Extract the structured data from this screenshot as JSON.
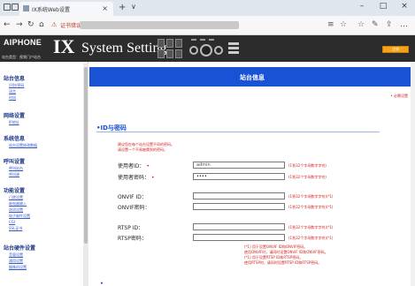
{
  "browser": {
    "tab_title": "IX系统Web设置",
    "tab_close": "×",
    "new_tab": "+",
    "tab_menu": "∨",
    "window_min": "–",
    "window_max": "□",
    "window_close": "×",
    "security_warning": "证书错误",
    "nav_back": "←",
    "nav_forward": "→",
    "nav_refresh": "↻",
    "nav_home": "⌂",
    "toolbar_icons": [
      "☆",
      "≡",
      "☆",
      "✎",
      "⇪",
      "…"
    ]
  },
  "app": {
    "brand": "AIPHONE",
    "product_short": "IX",
    "product_rest": "System Setting",
    "user_line": "站台类型：视频门户站台",
    "logout_label": "注销"
  },
  "sidebar": {
    "groups": [
      {
        "title": "站台信息",
        "items": [
          "识别/密码",
          "语言",
          "时间"
        ]
      },
      {
        "title": "网络设置",
        "items": [
          "IP地址"
        ]
      },
      {
        "title": "系统信息",
        "items": [
          "站台设置修改数据"
        ]
      },
      {
        "title": "呼叫设置",
        "items": [
          "呼叫站台",
          "呼叫源"
        ]
      },
      {
        "title": "功能设置",
        "items": [
          "门禁设置",
          "继电器输入",
          "选项设置",
          "电子邮件设置",
          "CGI",
          "SSL证书"
        ]
      },
      {
        "title": "站台硬件设置",
        "items": [
          "音量设置",
          "通用设置",
          "摄像机设置"
        ]
      }
    ]
  },
  "main": {
    "title": "站台信息",
    "required_note": "• 必需设置",
    "section_title": "•ID与密码",
    "description": [
      "建议您在每个站台设置不同的密码。",
      "请设置一个不易被猜到的密码。"
    ],
    "fields": [
      {
        "label": "使用者ID：",
        "required": "•",
        "value": "admin",
        "hint": "(1到32个字母数字字符)"
      },
      {
        "label": "使用者密码：",
        "required": "•",
        "value": "••••",
        "hint": "(1到32个字母数字字符)"
      },
      {
        "label": "ONVIF ID：",
        "required": "",
        "value": "",
        "hint": "(1到32个字母数字字符)(*1)"
      },
      {
        "label": "ONVIF密码：",
        "required": "",
        "value": "",
        "hint": "(1到32个字母数字字符)(*1)"
      },
      {
        "label": "RTSP ID：",
        "required": "",
        "value": "",
        "hint": "(1到32个字母数字字符)(*1)"
      },
      {
        "label": "RTSP密码：",
        "required": "",
        "value": "",
        "hint": "(1到32个字母数字字符)(*1)"
      }
    ],
    "notes": [
      "(*1) 用于设置ONVIF ID和ONVIF密码。",
      "使用ONVIF时，请同时设置ONVIF ID和ONVIF密码。",
      "(*1) 用于设置RTSP ID和RTSP密码。",
      "使用RTSP时，请同时设置RTSP ID和RTSP密码。"
    ],
    "next_section": "•"
  },
  "colors": {
    "title_bar": "#1a52d6",
    "header_bg": "#2c2c2c",
    "required_red": "#d32020",
    "logout_orange": "#f4a31a"
  }
}
